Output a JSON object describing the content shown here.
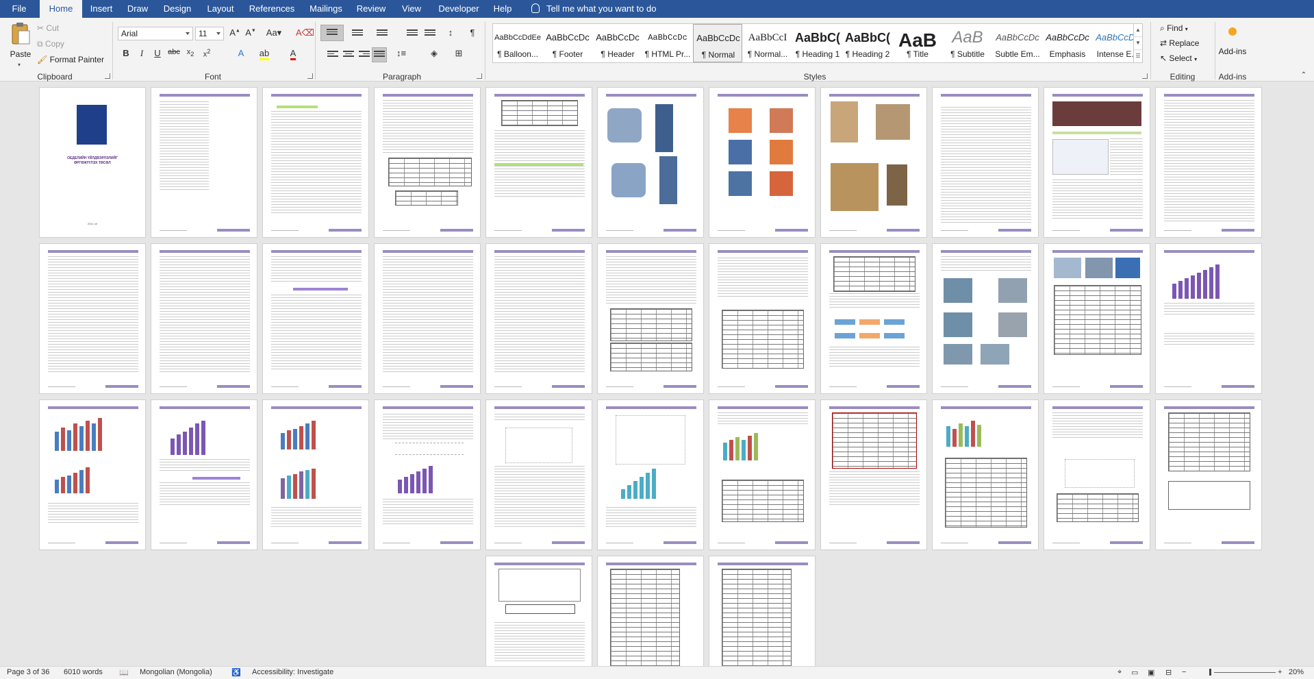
{
  "tabs": [
    "File",
    "Home",
    "Insert",
    "Draw",
    "Design",
    "Layout",
    "References",
    "Mailings",
    "Review",
    "View",
    "Developer",
    "Help"
  ],
  "tell_me": "Tell me what you want to do",
  "clipboard": {
    "paste": "Paste",
    "cut": "Cut",
    "copy": "Copy",
    "format_painter": "Format Painter",
    "label": "Clipboard"
  },
  "font": {
    "name": "Arial",
    "size": "11",
    "label": "Font"
  },
  "paragraph": {
    "label": "Paragraph"
  },
  "styles": {
    "label": "Styles",
    "items": [
      {
        "preview": "AaBbCcDdEe",
        "name": "¶ Balloon..."
      },
      {
        "preview": "AaBbCcDc",
        "name": "¶ Footer"
      },
      {
        "preview": "AaBbCcDc",
        "name": "¶ Header"
      },
      {
        "preview": "AaBbCcDc",
        "name": "¶ HTML Pr..."
      },
      {
        "preview": "AaBbCcDc",
        "name": "¶ Normal"
      },
      {
        "preview": "AaBbCcI",
        "name": "¶ Normal..."
      },
      {
        "preview": "AaBbC(",
        "name": "¶ Heading 1"
      },
      {
        "preview": "AaBbC(",
        "name": "¶ Heading 2"
      },
      {
        "preview": "AaB",
        "name": "¶ Title"
      },
      {
        "preview": "AaB",
        "name": "¶ Subtitle"
      },
      {
        "preview": "AaBbCcDc",
        "name": "Subtle Em..."
      },
      {
        "preview": "AaBbCcDc",
        "name": "Emphasis"
      },
      {
        "preview": "AaBbCcDc",
        "name": "Intense E..."
      }
    ]
  },
  "editing": {
    "find": "Find",
    "replace": "Replace",
    "select": "Select",
    "label": "Editing"
  },
  "addins": {
    "button": "Add-ins",
    "label": "Add-ins"
  },
  "cover": {
    "title_line1": "ОЕДЕЛИЙН ҮЙЛДВЭРЛЭЛИЙГ",
    "title_line2": "ӨРГӨЖҮҮЛЭХ ТӨСӨЛ",
    "year": "2011 он"
  },
  "status": {
    "page": "Page 3 of 36",
    "words": "6010 words",
    "language": "Mongolian (Mongolia)",
    "accessibility": "Accessibility: Investigate",
    "zoom": "20%"
  }
}
